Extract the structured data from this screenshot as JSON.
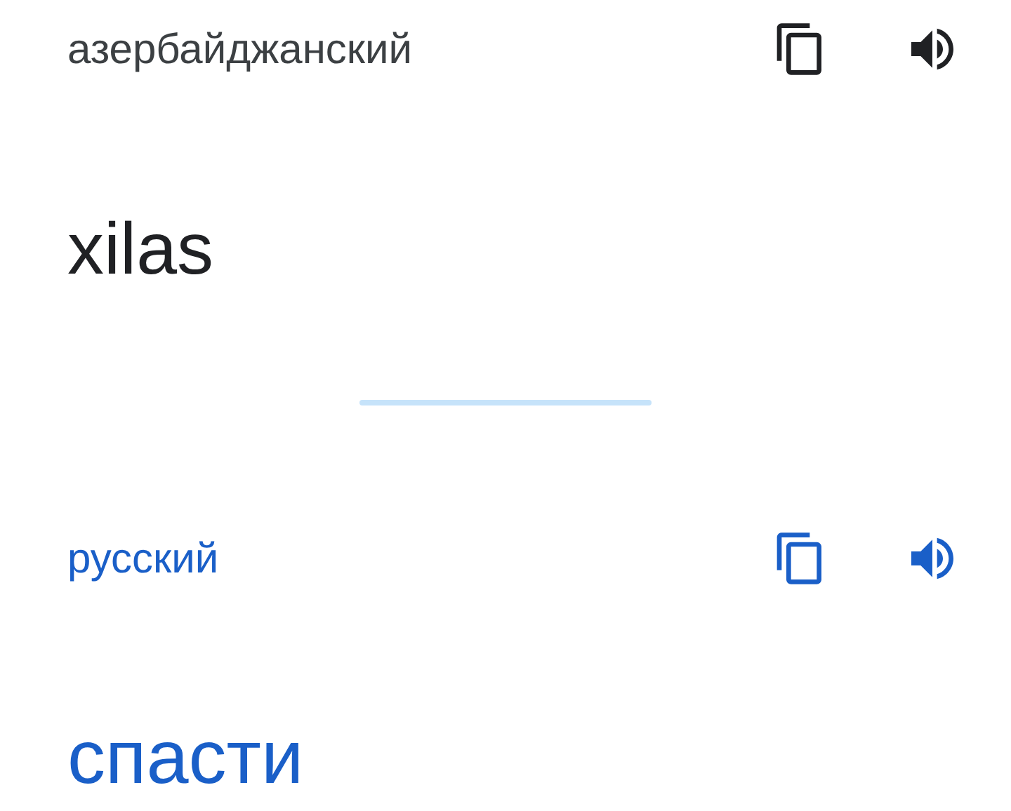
{
  "panels": [
    {
      "kind": "source",
      "language": "азербайджанский",
      "text": "xilas"
    },
    {
      "kind": "target",
      "language": "русский",
      "text": "спасти"
    }
  ]
}
